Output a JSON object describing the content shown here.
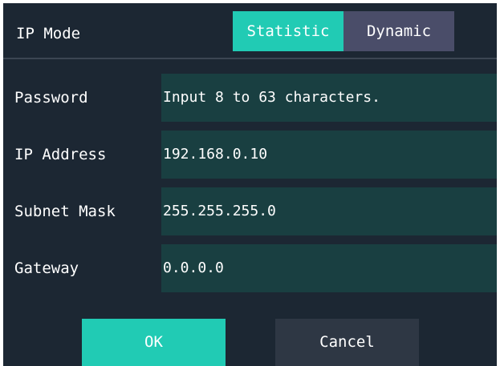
{
  "ip_mode": {
    "label": "IP Mode",
    "options": [
      "Statistic",
      "Dynamic"
    ],
    "selected": "Statistic"
  },
  "fields": {
    "password": {
      "label": "Password",
      "value": "",
      "placeholder": "Input 8 to 63 characters."
    },
    "ip_address": {
      "label": "IP Address",
      "value": "192.168.0.10"
    },
    "subnet_mask": {
      "label": "Subnet Mask",
      "value": "255.255.255.0"
    },
    "gateway": {
      "label": "Gateway",
      "value": "0.0.0.0"
    }
  },
  "buttons": {
    "ok": "OK",
    "cancel": "Cancel"
  },
  "colors": {
    "background": "#1c2733",
    "accent": "#21cbb4",
    "input_background": "#193f41",
    "inactive_toggle": "#4a4d69",
    "cancel_button": "#2e3744"
  }
}
